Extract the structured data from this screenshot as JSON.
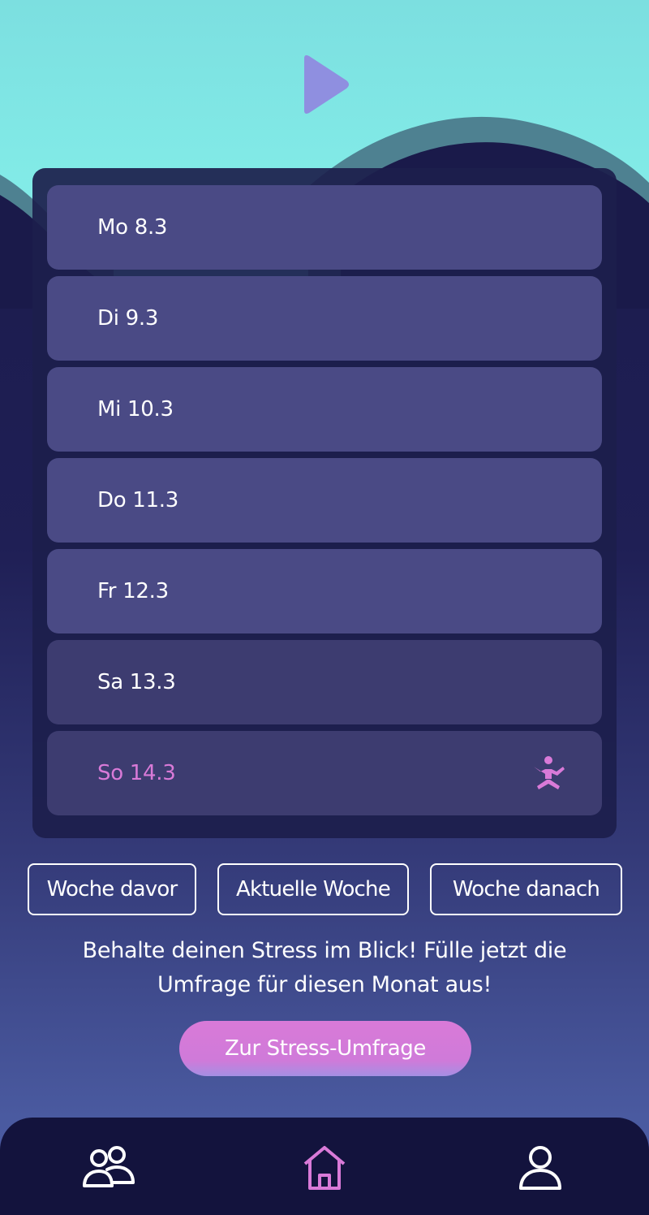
{
  "colors": {
    "sky": "#80e9e8",
    "wave_band": "#4e8191",
    "panel": "#1c1e4c",
    "day_row": "#4a4a85",
    "weekend_row": "#3d3c70",
    "accent_pink": "#d97ad8",
    "play_icon": "#8f8fe0",
    "nav_bg": "#13133d"
  },
  "header": {
    "play_icon": "play-icon"
  },
  "days": [
    {
      "label": "Mo 8.3"
    },
    {
      "label": "Di 9.3"
    },
    {
      "label": "Mi 10.3"
    },
    {
      "label": "Do 11.3"
    },
    {
      "label": "Fr 12.3"
    },
    {
      "label": "Sa 13.3"
    },
    {
      "label": "So 14.3",
      "icon": "meditation-icon"
    }
  ],
  "week_nav": {
    "prev": "Woche davor",
    "current": "Aktuelle Woche",
    "next": "Woche danach"
  },
  "reminder": {
    "line1": "Behalte deinen Stress im Blick! Fülle jetzt die",
    "line2": "Umfrage für diesen Monat aus!"
  },
  "survey_button": "Zur Stress-Umfrage",
  "bottom_nav": {
    "items": [
      {
        "icon": "community-icon"
      },
      {
        "icon": "home-icon",
        "active": true
      },
      {
        "icon": "profile-icon"
      }
    ]
  }
}
